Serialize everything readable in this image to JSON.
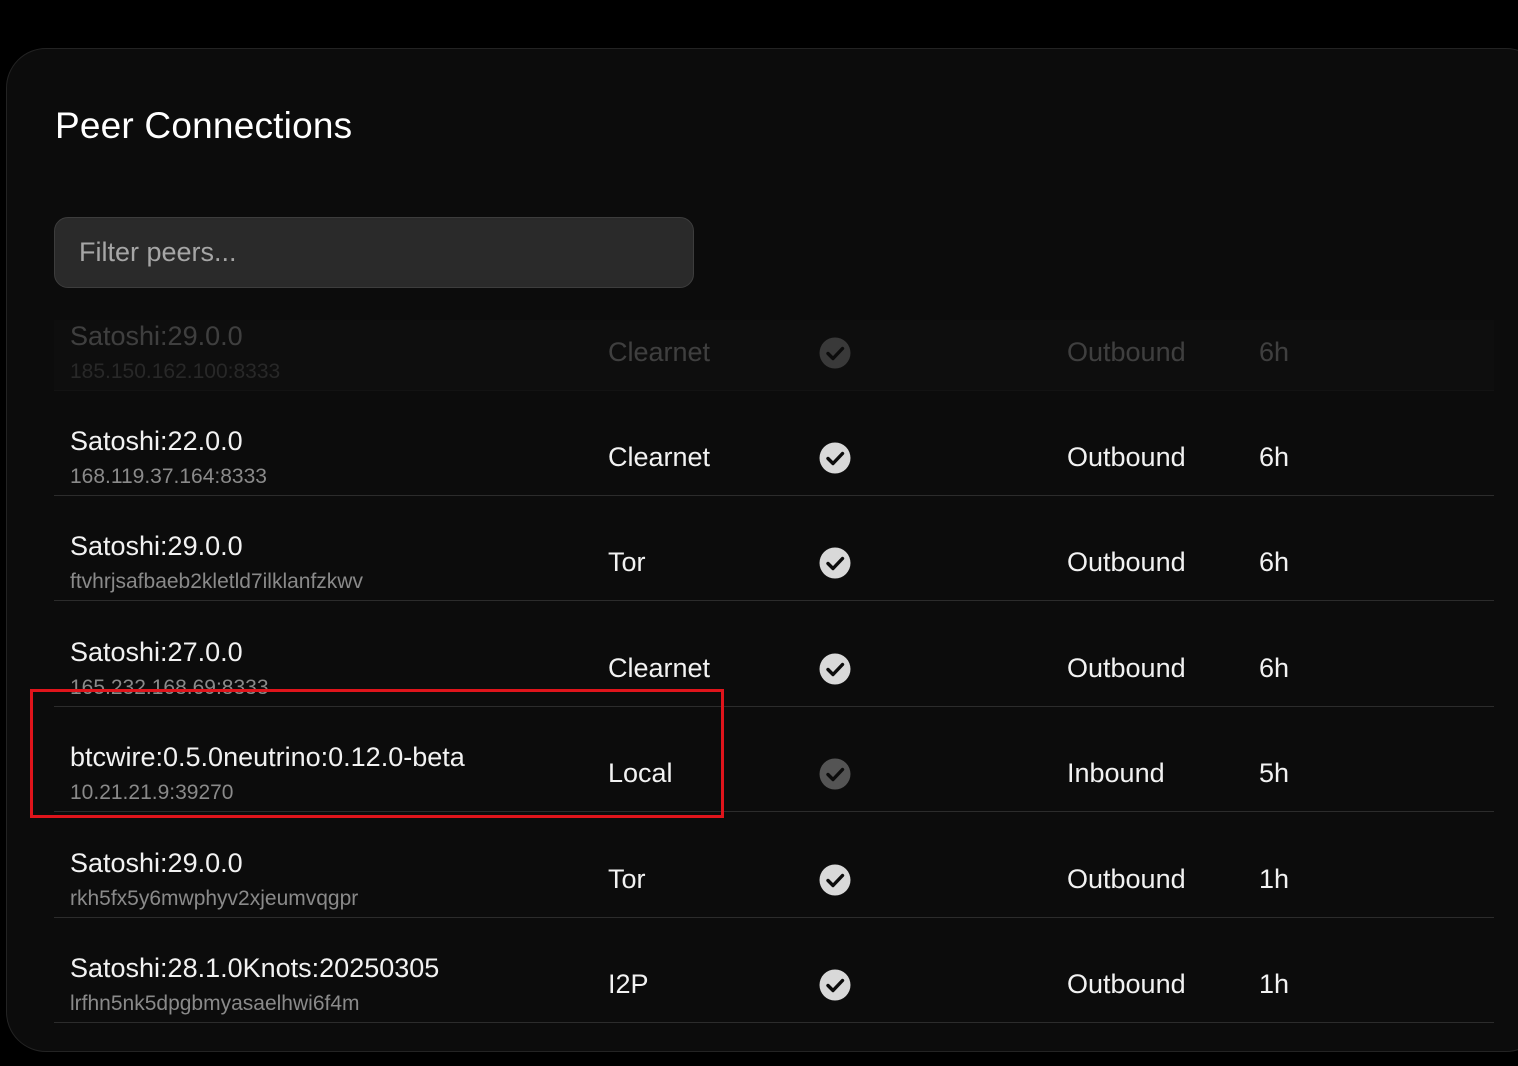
{
  "page": {
    "title": "Peer Connections",
    "filter_placeholder": "Filter peers..."
  },
  "colors": {
    "background": "#000000",
    "panel": "#0c0c0c",
    "text": "#f2f2f2",
    "muted_text": "#8a8a8a",
    "check": "#d9d9d9",
    "highlight": "#e0141b"
  },
  "icons": {
    "connected": "check-circle-icon"
  },
  "peers": [
    {
      "name": "Satoshi:29.0.0",
      "address": "185.150.162.100:8333",
      "network": "Clearnet",
      "direction": "Outbound",
      "duration": "6h"
    },
    {
      "name": "Satoshi:22.0.0",
      "address": "168.119.37.164:8333",
      "network": "Clearnet",
      "direction": "Outbound",
      "duration": "6h"
    },
    {
      "name": "Satoshi:29.0.0",
      "address": "ftvhrjsafbaeb2kletld7ilklanfzkwv",
      "network": "Tor",
      "direction": "Outbound",
      "duration": "6h"
    },
    {
      "name": "Satoshi:27.0.0",
      "address": "165.232.168.69:8333",
      "network": "Clearnet",
      "direction": "Outbound",
      "duration": "6h"
    },
    {
      "name": "btcwire:0.5.0neutrino:0.12.0-beta",
      "address": "10.21.21.9:39270",
      "network": "Local",
      "direction": "Inbound",
      "duration": "5h"
    },
    {
      "name": "Satoshi:29.0.0",
      "address": "rkh5fx5y6mwphyv2xjeumvqgpr",
      "network": "Tor",
      "direction": "Outbound",
      "duration": "1h"
    },
    {
      "name": "Satoshi:28.1.0Knots:20250305",
      "address": "lrfhn5nk5dpgbmyasaelhwi6f4m",
      "network": "I2P",
      "direction": "Outbound",
      "duration": "1h"
    }
  ]
}
